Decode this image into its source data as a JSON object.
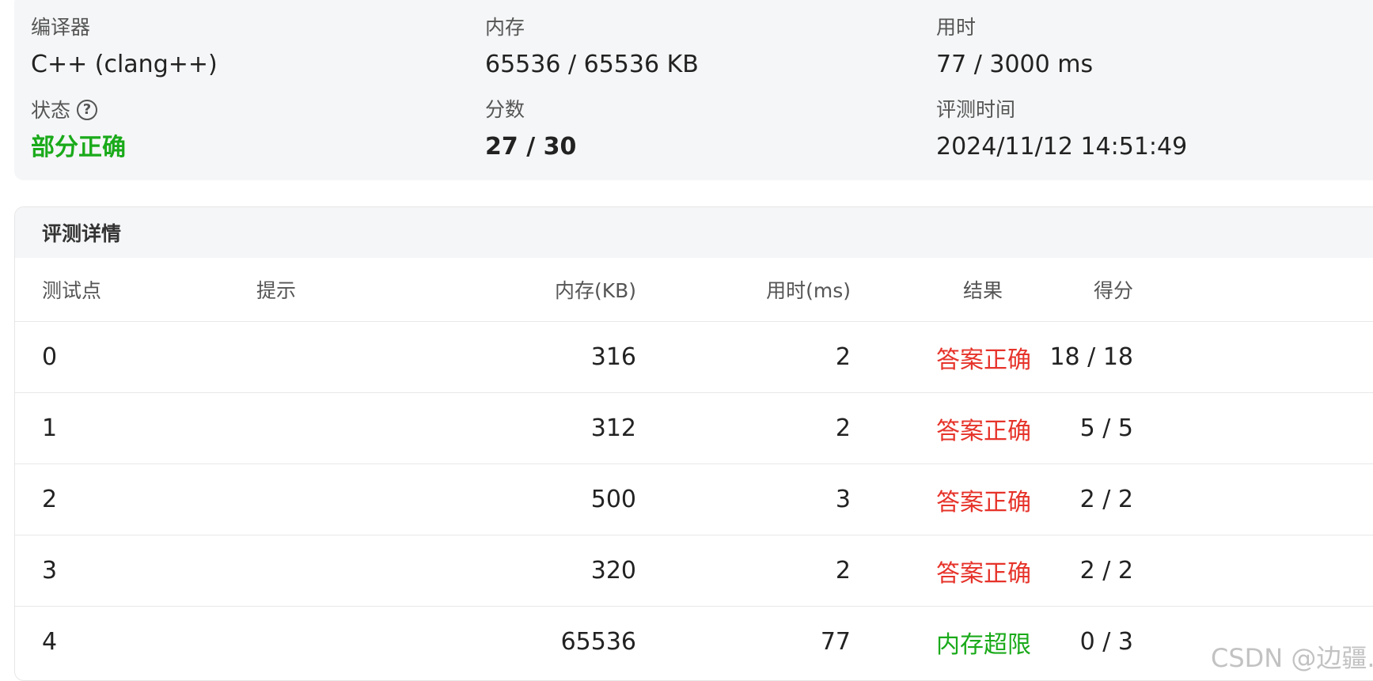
{
  "summary": {
    "compiler": {
      "label": "编译器",
      "value": "C++ (clang++)"
    },
    "memory": {
      "label": "内存",
      "value": "65536 / 65536 KB"
    },
    "time": {
      "label": "用时",
      "value": "77 / 3000 ms"
    },
    "status": {
      "label": "状态",
      "value": "部分正确",
      "help_icon": "question-circle-icon",
      "color": "#1aaa1a"
    },
    "score": {
      "label": "分数",
      "value": "27 / 30"
    },
    "judge_time": {
      "label": "评测时间",
      "value": "2024/11/12 14:51:49"
    }
  },
  "details": {
    "title": "评测详情",
    "columns": {
      "case": "测试点",
      "hint": "提示",
      "memory": "内存(KB)",
      "time": "用时(ms)",
      "result": "结果",
      "score": "得分"
    },
    "rows": [
      {
        "case": "0",
        "hint": "",
        "memory": "316",
        "time": "2",
        "result": "答案正确",
        "score": "18 / 18"
      },
      {
        "case": "1",
        "hint": "",
        "memory": "312",
        "time": "2",
        "result": "答案正确",
        "score": "5 / 5"
      },
      {
        "case": "2",
        "hint": "",
        "memory": "500",
        "time": "3",
        "result": "答案正确",
        "score": "2 / 2"
      },
      {
        "case": "3",
        "hint": "",
        "memory": "320",
        "time": "2",
        "result": "答案正确",
        "score": "2 / 2"
      },
      {
        "case": "4",
        "hint": "",
        "memory": "65536",
        "time": "77",
        "result": "内存超限",
        "score": "0 / 3"
      }
    ],
    "colors": {
      "accepted": "#e6332a",
      "memory_limit": "#1aaa1a"
    }
  },
  "watermark": "CSDN @边疆."
}
